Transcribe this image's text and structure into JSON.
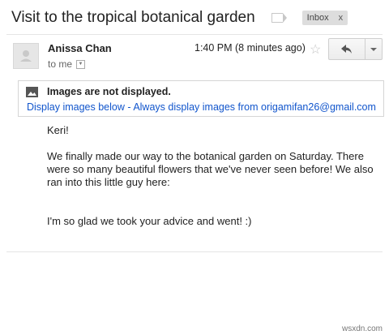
{
  "email": {
    "subject": "Visit to the tropical botanical garden",
    "label": "Inbox",
    "label_remove": "x",
    "sender": {
      "name": "Anissa Chan",
      "recipient": "to me",
      "timestamp": "1:40 PM (8 minutes ago)"
    },
    "images_banner": {
      "title": "Images are not displayed.",
      "display_below": "Display images below",
      "separator": " - ",
      "always_display": "Always display images from origamifan26@gmail.com"
    },
    "body": {
      "greeting": "Keri!",
      "paragraph": "We finally made our way to the botanical garden on Saturday. There were so many beautiful flowers that we've never seen before! We also ran into this little guy here:",
      "closing": "I'm so glad we took your advice and went! :)"
    }
  },
  "icons": {
    "avatar": "person-silhouette-icon",
    "star": "star-outline-icon",
    "reply": "reply-arrow-icon",
    "more": "caret-down-icon",
    "image": "image-placeholder-icon",
    "important": "important-marker-icon"
  },
  "colors": {
    "link": "#1155cc",
    "label_chip": "#dddddd",
    "star": "#c4c4c4"
  },
  "watermark": "wsxdn.com"
}
